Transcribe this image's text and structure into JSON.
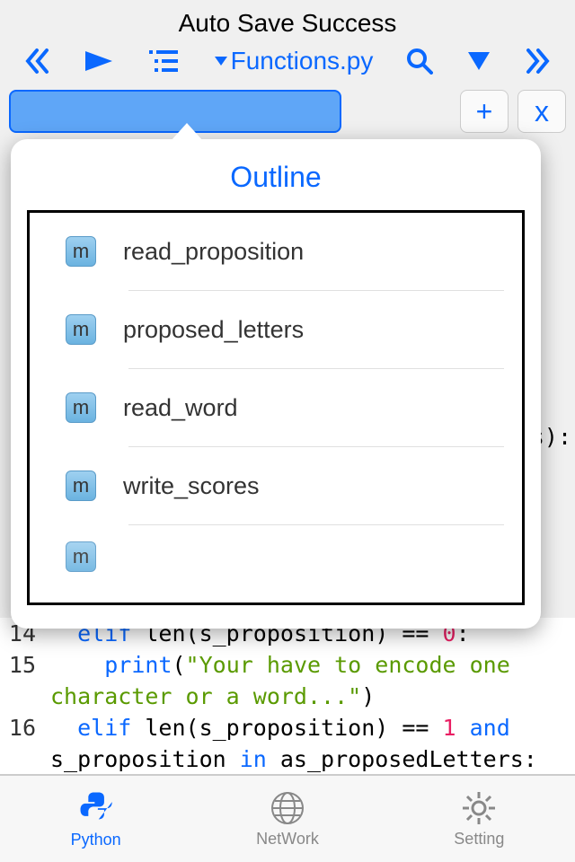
{
  "header": {
    "title": "Auto Save Success"
  },
  "toolbar": {
    "filename": "Functions.py"
  },
  "tabs": {
    "active_label": ""
  },
  "popover": {
    "title": "Outline",
    "items": [
      {
        "badge": "m",
        "label": "read_proposition"
      },
      {
        "badge": "m",
        "label": "proposed_letters"
      },
      {
        "badge": "m",
        "label": "read_word"
      },
      {
        "badge": "m",
        "label": "write_scores"
      }
    ]
  },
  "code": {
    "line14": {
      "no": "14",
      "kw1": "elif",
      "mid": " len(s_proposition) == ",
      "num": "0",
      "tail": ":"
    },
    "line15": {
      "no": "15",
      "kw": "print",
      "str": "\"Your have to encode one character or a word...\"",
      "open": "(",
      "close": ")"
    },
    "line16": {
      "no": "16",
      "kw1": "elif",
      "mid1": " len(s_proposition) == ",
      "num": "1",
      "kw2": " and",
      "cont": "s_proposition ",
      "kw3": "in",
      "tail": " as_proposedLetters:"
    }
  },
  "bg_tail": "s):",
  "nav": {
    "python": "Python",
    "network": "NetWork",
    "setting": "Setting"
  }
}
